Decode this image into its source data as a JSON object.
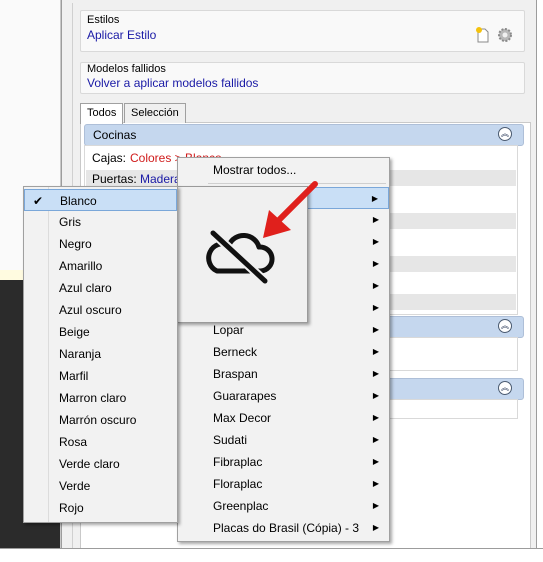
{
  "estilos": {
    "title": "Estilos",
    "apply_link": "Aplicar Estilo"
  },
  "fallidos": {
    "title": "Modelos fallidos",
    "reapply_link": "Volver a aplicar modelos fallidos"
  },
  "tabs": [
    {
      "label": "Todos"
    },
    {
      "label": "Selección"
    }
  ],
  "cocinas": {
    "header": "Cocinas",
    "cajas_label": "Cajas:",
    "cajas_value": "Colores > Blanco",
    "puertas_label": "Puertas:",
    "puertas_value": "Madera"
  },
  "brand_menu": {
    "show_all": "Mostrar todos...",
    "items": [
      "Lopar",
      "Berneck",
      "Braspan",
      "Guararapes",
      "Max Decor",
      "Sudati",
      "Fibraplac",
      "Floraplac",
      "Greenplac",
      "Placas do Brasil (Cópia) - 3"
    ]
  },
  "color_menu": {
    "checkmark": "✔",
    "items": [
      "Blanco",
      "Gris",
      "Negro",
      "Amarillo",
      "Azul claro",
      "Azul oscuro",
      "Beige",
      "Naranja",
      "Marfil",
      "Marron claro",
      "Marrón oscuro",
      "Rosa",
      "Verde claro",
      "Verde",
      "Rojo"
    ]
  },
  "icons": {
    "new_style": "new-document-icon",
    "settings": "gear-icon",
    "collapse": "collapse-chevrons-icon",
    "preview": "cloud-off-icon",
    "pointer": "red-arrow-icon"
  },
  "colors": {
    "accent_header": "#c5d7ee",
    "selection": "#c9dff6",
    "link": "#1a1aa6",
    "link_red": "#d01b1b",
    "arrow": "#e0201c"
  }
}
